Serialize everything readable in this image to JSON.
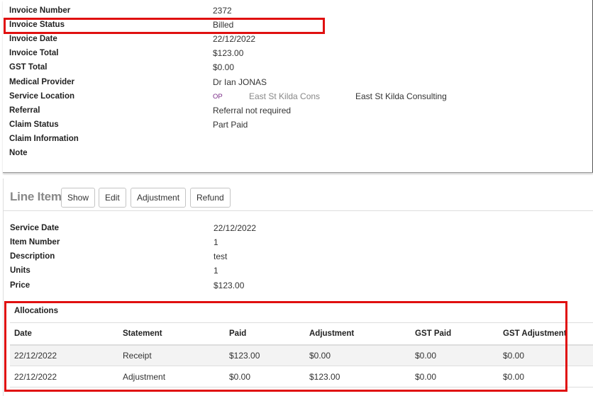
{
  "invoice": {
    "fields": [
      {
        "label": "Invoice Number",
        "value": "2372"
      },
      {
        "label": "Invoice Status",
        "value": "Billed"
      },
      {
        "label": "Invoice Date",
        "value": "22/12/2022"
      },
      {
        "label": "Invoice Total",
        "value": "$123.00"
      },
      {
        "label": "GST Total",
        "value": "$0.00"
      },
      {
        "label": "Medical Provider",
        "value": "Dr Ian JONAS"
      },
      {
        "label": "Service Location",
        "value": ""
      },
      {
        "label": "Referral",
        "value": "Referral not required"
      },
      {
        "label": "Claim Status",
        "value": "Part Paid"
      },
      {
        "label": "Claim Information",
        "value": ""
      },
      {
        "label": "Note",
        "value": ""
      }
    ],
    "service_location": {
      "code_badge": "OP",
      "code": "East St Kilda Cons",
      "name": "East St Kilda Consulting"
    }
  },
  "line_item": {
    "title": "Line Item",
    "buttons": {
      "show": "Show",
      "edit": "Edit",
      "adjustment": "Adjustment",
      "refund": "Refund"
    },
    "fields": [
      {
        "label": "Service Date",
        "value": "22/12/2022"
      },
      {
        "label": "Item Number",
        "value": "1"
      },
      {
        "label": "Description",
        "value": "test"
      },
      {
        "label": "Units",
        "value": "1"
      },
      {
        "label": "Price",
        "value": "$123.00"
      }
    ]
  },
  "allocations": {
    "title": "Allocations",
    "columns": [
      "Date",
      "Statement",
      "Paid",
      "Adjustment",
      "GST Paid",
      "GST Adjustment"
    ],
    "rows": [
      [
        "22/12/2022",
        "Receipt",
        "$123.00",
        "$0.00",
        "$0.00",
        "$0.00"
      ],
      [
        "22/12/2022",
        "Adjustment",
        "$0.00",
        "$123.00",
        "$0.00",
        "$0.00"
      ]
    ]
  },
  "colors": {
    "highlight": "#e01010",
    "link": "#3a5ea8",
    "badge": "#7a2b87"
  }
}
